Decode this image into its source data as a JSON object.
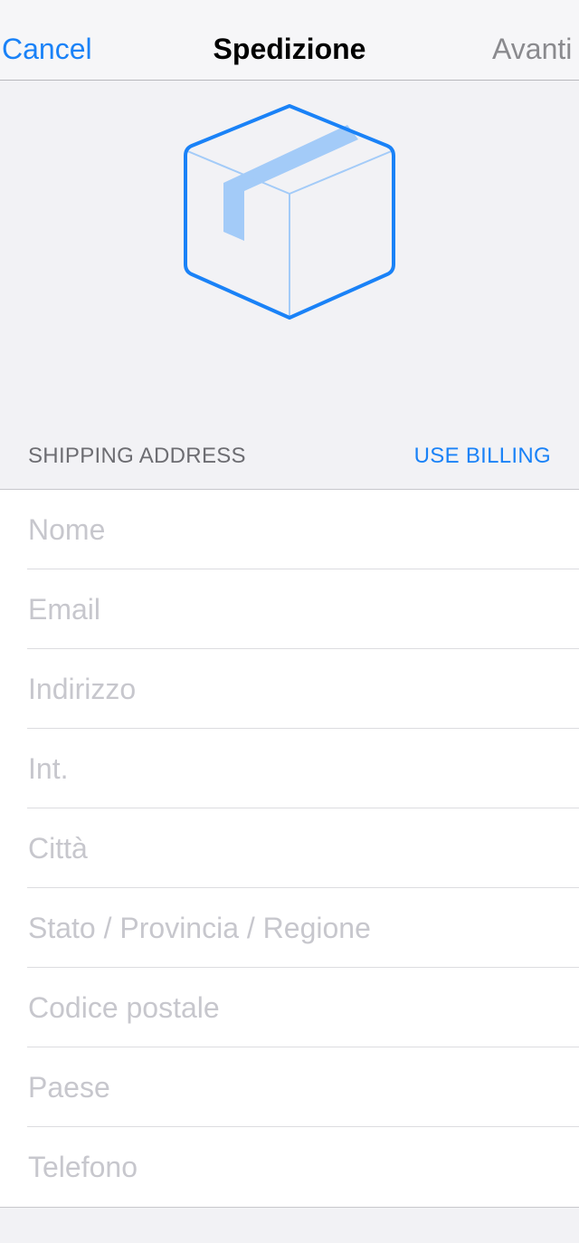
{
  "nav": {
    "cancel_label": "Cancel",
    "title": "Spedizione",
    "next_label": "Avanti"
  },
  "hero": {
    "icon": "package-box-icon",
    "accent_color": "#1a82f7",
    "tape_color": "#a3cbf8"
  },
  "section": {
    "title": "SHIPPING ADDRESS",
    "action_label": "USE BILLING"
  },
  "form": {
    "fields": [
      {
        "name": "nome-field",
        "placeholder": "Nome",
        "value": ""
      },
      {
        "name": "email-field",
        "placeholder": "Email",
        "value": ""
      },
      {
        "name": "indirizzo-field",
        "placeholder": "Indirizzo",
        "value": ""
      },
      {
        "name": "int-field",
        "placeholder": "Int.",
        "value": ""
      },
      {
        "name": "citta-field",
        "placeholder": "Città",
        "value": ""
      },
      {
        "name": "stato-field",
        "placeholder": "Stato / Provincia / Regione",
        "value": ""
      },
      {
        "name": "codice-postale-field",
        "placeholder": "Codice postale",
        "value": ""
      },
      {
        "name": "paese-field",
        "placeholder": "Paese",
        "value": ""
      },
      {
        "name": "telefono-field",
        "placeholder": "Telefono",
        "value": ""
      }
    ]
  }
}
